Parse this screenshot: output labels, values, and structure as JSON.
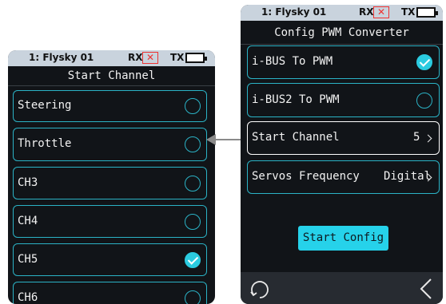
{
  "left_screen": {
    "status": {
      "model": "1: Flysky  01",
      "rx": "RX",
      "tx": "TX"
    },
    "title": "Start Channel",
    "items": [
      {
        "label": "Steering",
        "checked": false
      },
      {
        "label": "Throttle",
        "checked": false
      },
      {
        "label": "CH3",
        "checked": false
      },
      {
        "label": "CH4",
        "checked": false
      },
      {
        "label": "CH5",
        "checked": true
      },
      {
        "label": "CH6",
        "checked": false
      }
    ]
  },
  "right_screen": {
    "status": {
      "model": "1: Flysky  01",
      "rx": "RX",
      "tx": "TX"
    },
    "title": "Config PWM Converter",
    "items": [
      {
        "label": "i-BUS To PWM",
        "checked": true
      },
      {
        "label": "i-BUS2 To PWM",
        "checked": false
      }
    ],
    "start_channel": {
      "label": "Start Channel",
      "value": "5"
    },
    "servos_frequency": {
      "label": "Servos Frequency",
      "value": "Digital"
    },
    "start_config_label": "Start Config"
  },
  "icons": {
    "rx_status": "x-mark-icon",
    "battery": "battery-icon",
    "checked": "check-circle-icon",
    "unchecked": "empty-circle-icon",
    "chevron": "chevron-right-icon",
    "rotate": "rotate-icon",
    "back": "back-chevron-icon",
    "arrow": "arrow-left-icon"
  },
  "colors": {
    "accent": "#2bb3c6",
    "check_fill": "#2bcbe0",
    "button": "#26d2ea",
    "screen_bg": "#111418",
    "status_bar": "#c9d3dd",
    "rx_error": "#e33333"
  }
}
